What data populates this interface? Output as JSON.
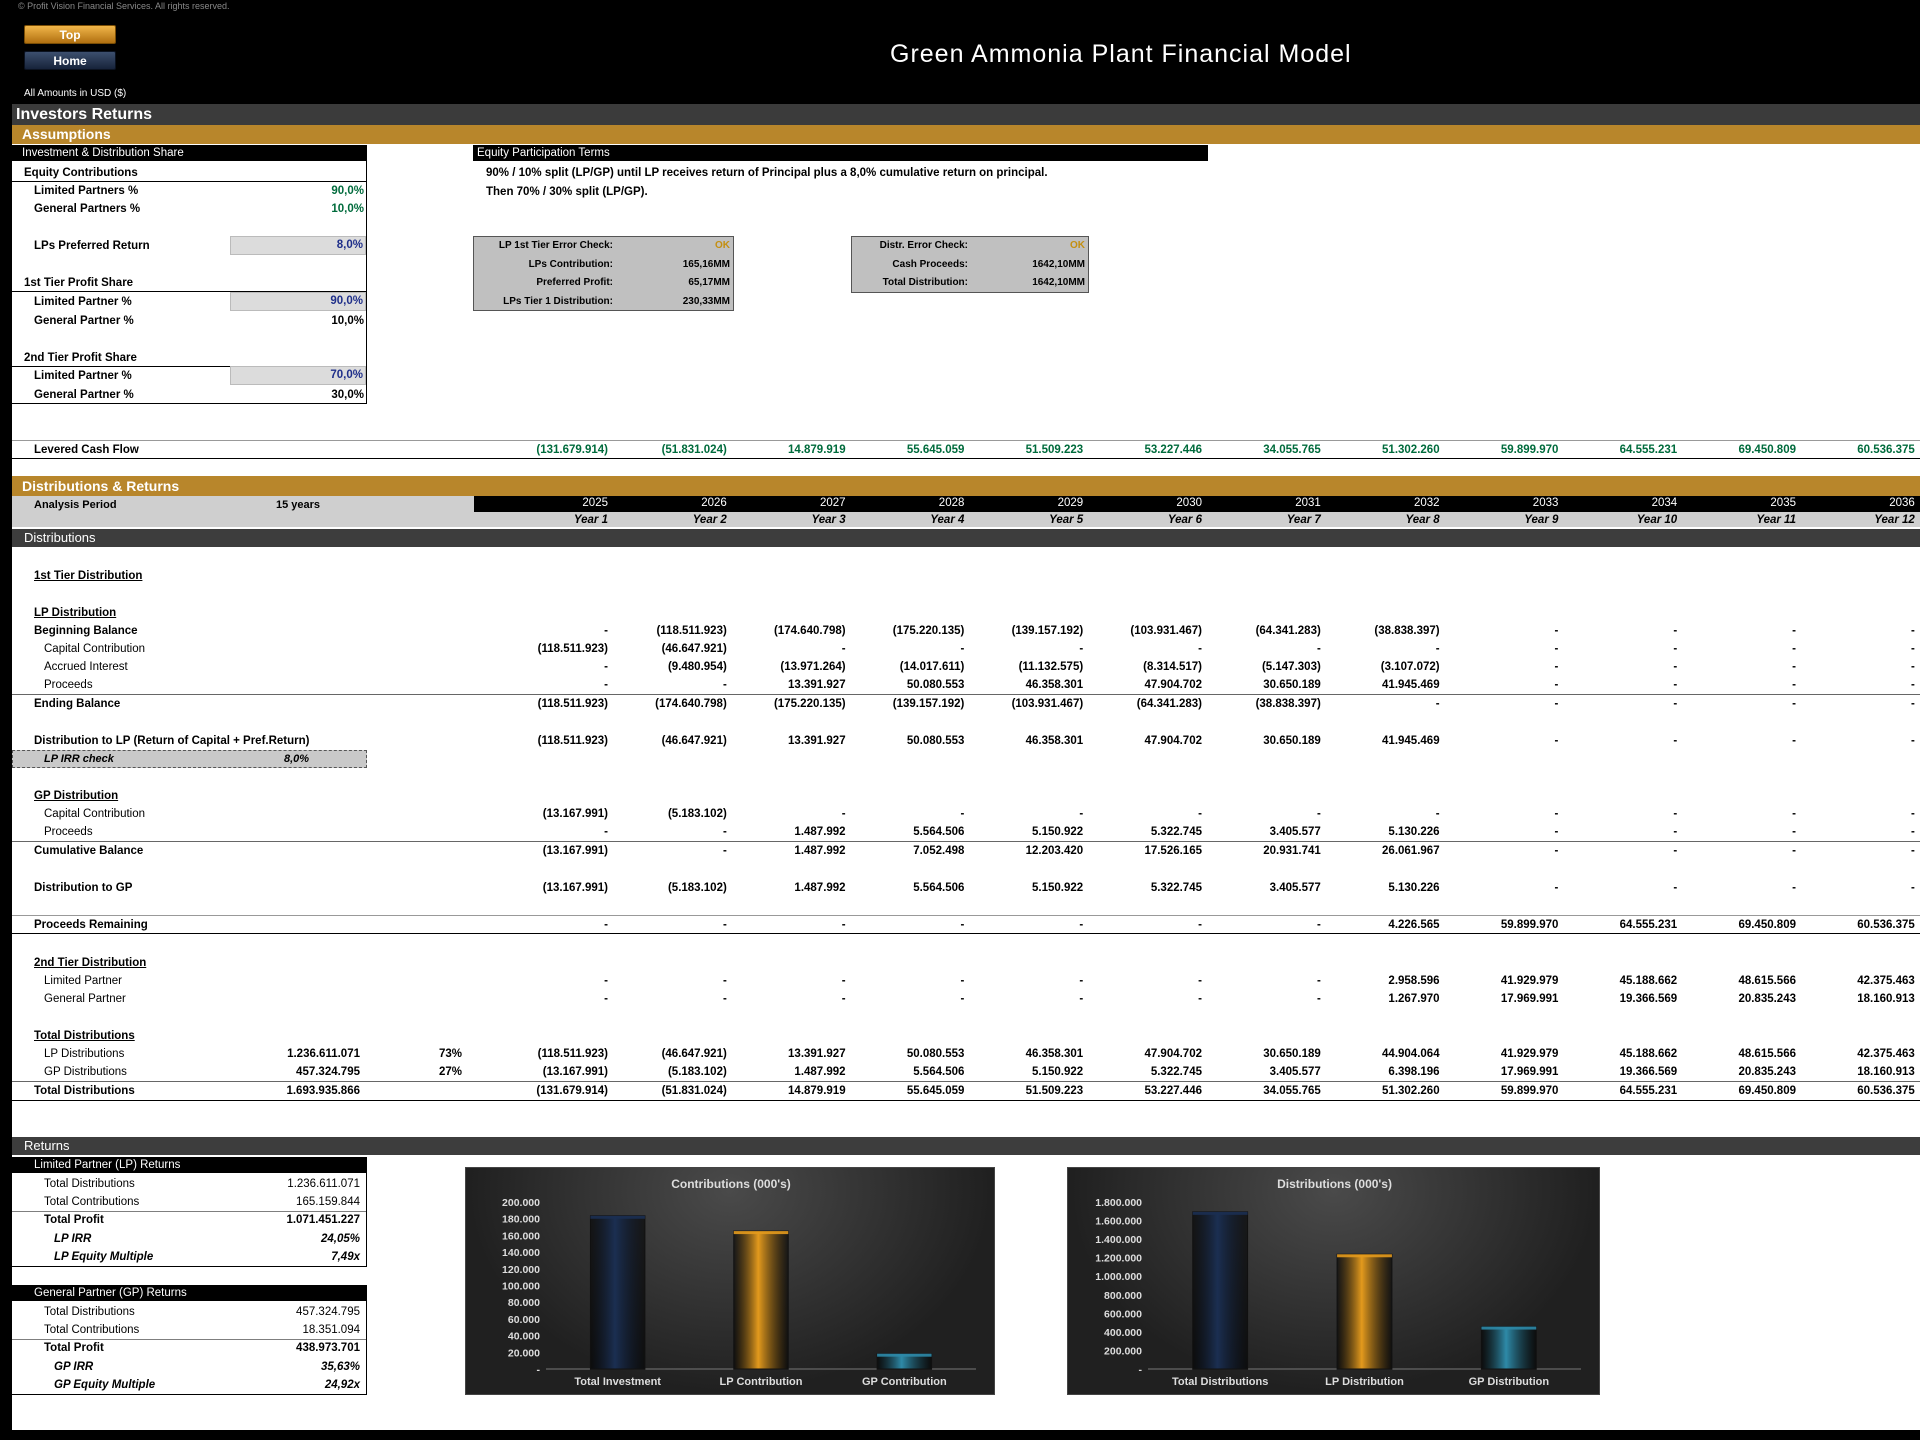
{
  "header": {
    "copyright": "© Profit Vision Financial Services. All rights reserved.",
    "top_btn": "Top",
    "home_btn": "Home",
    "title": "Green Ammonia Plant Financial Model",
    "amounts": "All Amounts in  USD ($)"
  },
  "page": {
    "title": "Investors Returns",
    "assumptions": "Assumptions",
    "dist_returns": "Distributions & Returns",
    "distributions": "Distributions",
    "returns": "Returns"
  },
  "invest": {
    "header": "Investment & Distribution Share",
    "equity": "Equity Contributions",
    "lp_label": "Limited Partners %",
    "lp_val": "90,0%",
    "gp_label": "General Partners %",
    "gp_val": "10,0%",
    "pref_label": "LPs Preferred Return",
    "pref_val": "8,0%",
    "tier1": "1st Tier Profit Share",
    "t1_lp_label": "Limited Partner %",
    "t1_lp_val": "90,0%",
    "t1_gp_label": "General Partner %",
    "t1_gp_val": "10,0%",
    "tier2": "2nd Tier Profit Share",
    "t2_lp_label": "Limited Partner %",
    "t2_lp_val": "70,0%",
    "t2_gp_label": "General Partner %",
    "t2_gp_val": "30,0%"
  },
  "equity_terms": {
    "header": "Equity Participation Terms",
    "line1": "90% / 10% split (LP/GP) until LP receives return of Principal plus a 8,0% cumulative return on principal.",
    "line2": "Then 70% / 30% split (LP/GP)."
  },
  "check1": {
    "rows": [
      {
        "label": "LP 1st Tier Error Check:",
        "value": "OK"
      },
      {
        "label": "LPs Contribution:",
        "value": "165,16MM"
      },
      {
        "label": "Preferred Profit:",
        "value": "65,17MM"
      },
      {
        "label": "LPs Tier 1 Distribution:",
        "value": "230,33MM"
      }
    ]
  },
  "check2": {
    "rows": [
      {
        "label": "Distr. Error Check:",
        "value": "OK"
      },
      {
        "label": "Cash Proceeds:",
        "value": "1642,10MM"
      },
      {
        "label": "Total Distribution:",
        "value": "1642,10MM"
      }
    ]
  },
  "levered": {
    "label": "Levered Cash Flow",
    "values": [
      "(131.679.914)",
      "(51.831.024)",
      "14.879.919",
      "55.645.059",
      "51.509.223",
      "53.227.446",
      "34.055.765",
      "51.302.260",
      "59.899.970",
      "64.555.231",
      "69.450.809",
      "60.536.375"
    ]
  },
  "period": {
    "label": "Analysis Period",
    "value": "15 years",
    "years": [
      "2025",
      "2026",
      "2027",
      "2028",
      "2029",
      "2030",
      "2031",
      "2032",
      "2033",
      "2034",
      "2035",
      "2036"
    ],
    "year_labels": [
      "Year 1",
      "Year 2",
      "Year 3",
      "Year 4",
      "Year 5",
      "Year 6",
      "Year 7",
      "Year 8",
      "Year 9",
      "Year 10",
      "Year 11",
      "Year 12"
    ]
  },
  "dist": {
    "tier1_title": "1st Tier Distribution",
    "lp_title": "LP Distribution",
    "beginning": {
      "label": "Beginning Balance",
      "values": [
        "-",
        "(118.511.923)",
        "(174.640.798)",
        "(175.220.135)",
        "(139.157.192)",
        "(103.931.467)",
        "(64.341.283)",
        "(38.838.397)",
        "-",
        "-",
        "-",
        "-"
      ]
    },
    "capital": {
      "label": "Capital Contribution",
      "values": [
        "(118.511.923)",
        "(46.647.921)",
        "-",
        "-",
        "-",
        "-",
        "-",
        "-",
        "-",
        "-",
        "-",
        "-"
      ]
    },
    "accrued": {
      "label": "Accrued Interest",
      "values": [
        "-",
        "(9.480.954)",
        "(13.971.264)",
        "(14.017.611)",
        "(11.132.575)",
        "(8.314.517)",
        "(5.147.303)",
        "(3.107.072)",
        "-",
        "-",
        "-",
        "-"
      ]
    },
    "proceeds": {
      "label": "Proceeds",
      "values": [
        "-",
        "-",
        "13.391.927",
        "50.080.553",
        "46.358.301",
        "47.904.702",
        "30.650.189",
        "41.945.469",
        "-",
        "-",
        "-",
        "-"
      ]
    },
    "ending": {
      "label": "Ending Balance",
      "values": [
        "(118.511.923)",
        "(174.640.798)",
        "(175.220.135)",
        "(139.157.192)",
        "(103.931.467)",
        "(64.341.283)",
        "(38.838.397)",
        "-",
        "-",
        "-",
        "-",
        "-"
      ]
    },
    "dist_lp": {
      "label": "Distribution to LP (Return of Capital + Pref.Return)",
      "values": [
        "(118.511.923)",
        "(46.647.921)",
        "13.391.927",
        "50.080.553",
        "46.358.301",
        "47.904.702",
        "30.650.189",
        "41.945.469",
        "-",
        "-",
        "-",
        "-"
      ]
    },
    "irr_check": {
      "label": "LP IRR check",
      "value": "8,0%"
    },
    "gp_title": "GP Distribution",
    "gp_capital": {
      "label": "Capital Contribution",
      "values": [
        "(13.167.991)",
        "(5.183.102)",
        "-",
        "-",
        "-",
        "-",
        "-",
        "-",
        "-",
        "-",
        "-",
        "-"
      ]
    },
    "gp_proceeds": {
      "label": "Proceeds",
      "values": [
        "-",
        "-",
        "1.487.992",
        "5.564.506",
        "5.150.922",
        "5.322.745",
        "3.405.577",
        "5.130.226",
        "-",
        "-",
        "-",
        "-"
      ]
    },
    "gp_cum": {
      "label": "Cumulative Balance",
      "values": [
        "(13.167.991)",
        "-",
        "1.487.992",
        "7.052.498",
        "12.203.420",
        "17.526.165",
        "20.931.741",
        "26.061.967",
        "-",
        "-",
        "-",
        "-"
      ]
    },
    "dist_gp": {
      "label": "Distribution to GP",
      "values": [
        "(13.167.991)",
        "(5.183.102)",
        "1.487.992",
        "5.564.506",
        "5.150.922",
        "5.322.745",
        "3.405.577",
        "5.130.226",
        "-",
        "-",
        "-",
        "-"
      ]
    },
    "remaining": {
      "label": "Proceeds Remaining",
      "values": [
        "-",
        "-",
        "-",
        "-",
        "-",
        "-",
        "-",
        "4.226.565",
        "59.899.970",
        "64.555.231",
        "69.450.809",
        "60.536.375"
      ]
    },
    "tier2_title": "2nd Tier Distribution",
    "t2_lp": {
      "label": "Limited Partner",
      "values": [
        "-",
        "-",
        "-",
        "-",
        "-",
        "-",
        "-",
        "2.958.596",
        "41.929.979",
        "45.188.662",
        "48.615.566",
        "42.375.463"
      ]
    },
    "t2_gp": {
      "label": "General Partner",
      "values": [
        "-",
        "-",
        "-",
        "-",
        "-",
        "-",
        "-",
        "1.267.970",
        "17.969.991",
        "19.366.569",
        "20.835.243",
        "18.160.913"
      ]
    },
    "total_title": "Total Distributions",
    "tot_lp": {
      "label": "LP Distributions",
      "total": "1.236.611.071",
      "pct": "73%",
      "values": [
        "(118.511.923)",
        "(46.647.921)",
        "13.391.927",
        "50.080.553",
        "46.358.301",
        "47.904.702",
        "30.650.189",
        "44.904.064",
        "41.929.979",
        "45.188.662",
        "48.615.566",
        "42.375.463"
      ]
    },
    "tot_gp": {
      "label": "GP Distributions",
      "total": "457.324.795",
      "pct": "27%",
      "values": [
        "(13.167.991)",
        "(5.183.102)",
        "1.487.992",
        "5.564.506",
        "5.150.922",
        "5.322.745",
        "3.405.577",
        "6.398.196",
        "17.969.991",
        "19.366.569",
        "20.835.243",
        "18.160.913"
      ]
    },
    "tot_all": {
      "label": "Total Distributions",
      "total": "1.693.935.866",
      "values": [
        "(131.679.914)",
        "(51.831.024)",
        "14.879.919",
        "55.645.059",
        "51.509.223",
        "53.227.446",
        "34.055.765",
        "51.302.260",
        "59.899.970",
        "64.555.231",
        "69.450.809",
        "60.536.375"
      ]
    }
  },
  "lp_returns": {
    "header": "Limited Partner (LP) Returns",
    "dist_label": "Total Distributions",
    "dist_val": "1.236.611.071",
    "contrib_label": "Total Contributions",
    "contrib_val": "165.159.844",
    "profit_label": "Total Profit",
    "profit_val": "1.071.451.227",
    "irr_label": "LP IRR",
    "irr_val": "24,05%",
    "mult_label": "LP Equity Multiple",
    "mult_val": "7,49x"
  },
  "gp_returns": {
    "header": "General Partner (GP) Returns",
    "dist_label": "Total Distributions",
    "dist_val": "457.324.795",
    "contrib_label": "Total Contributions",
    "contrib_val": "18.351.094",
    "profit_label": "Total Profit",
    "profit_val": "438.973.701",
    "irr_label": "GP IRR",
    "irr_val": "35,63%",
    "mult_label": "GP Equity Multiple",
    "mult_val": "24,92x"
  },
  "chart_data": [
    {
      "type": "bar",
      "title": "Contributions (000's)",
      "categories": [
        "Total Investment",
        "LP Contribution",
        "GP Contribution"
      ],
      "values": [
        183511,
        165160,
        18351
      ],
      "ylim": [
        0,
        200000
      ],
      "yticks": [
        "200.000",
        "180.000",
        "160.000",
        "140.000",
        "120.000",
        "100.000",
        "80.000",
        "60.000",
        "40.000",
        "20.000",
        "-"
      ],
      "colors": [
        "#1b2f52",
        "#e39a1d",
        "#2e8aa8"
      ]
    },
    {
      "type": "bar",
      "title": "Distributions (000's)",
      "categories": [
        "Total Distributions",
        "LP Distribution",
        "GP Distribution"
      ],
      "values": [
        1693936,
        1236611,
        457325
      ],
      "ylim": [
        0,
        1800000
      ],
      "yticks": [
        "1.800.000",
        "1.600.000",
        "1.400.000",
        "1.200.000",
        "1.000.000",
        "800.000",
        "600.000",
        "400.000",
        "200.000",
        "-"
      ],
      "colors": [
        "#1b2f52",
        "#e39a1d",
        "#2e8aa8"
      ]
    }
  ]
}
